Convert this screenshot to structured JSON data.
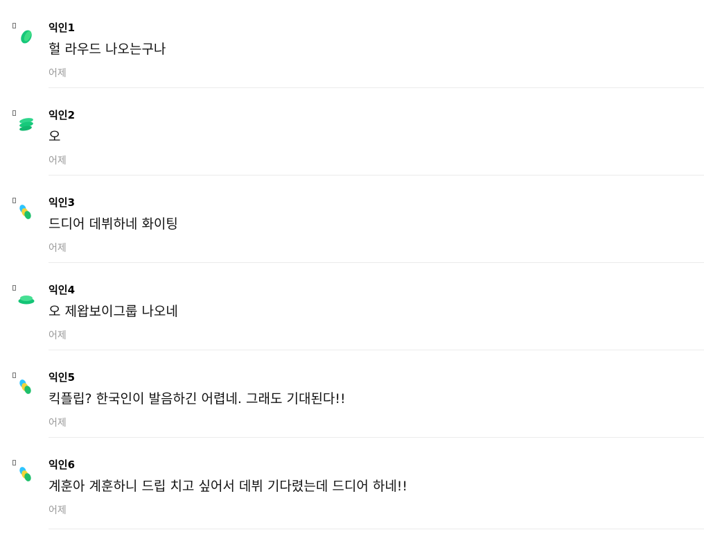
{
  "comments": [
    {
      "nickname": "익인1",
      "text": "헐 라우드 나오는구나",
      "time": "어제",
      "avatar_icon": "green-leaf-icon",
      "avatar_colors": [
        "#16c77a",
        "#3ddc84"
      ]
    },
    {
      "nickname": "익인2",
      "text": "오",
      "time": "어제",
      "avatar_icon": "green-stack-icon",
      "avatar_colors": [
        "#17c97b",
        "#2fd58c"
      ]
    },
    {
      "nickname": "익인3",
      "text": "드디어 데뷔하네 화이팅",
      "time": "어제",
      "avatar_icon": "colorful-bubbles-icon",
      "avatar_colors": [
        "#2ec4ff",
        "#f2d43a",
        "#1fbf6b"
      ]
    },
    {
      "nickname": "익인4",
      "text": "오 제왑보이그룹 나오네",
      "time": "어제",
      "avatar_icon": "green-cushion-icon",
      "avatar_colors": [
        "#14c476",
        "#46df93"
      ]
    },
    {
      "nickname": "익인5",
      "text": "킥플립? 한국인이 발음하긴 어렵네. 그래도 기대된다!!",
      "time": "어제",
      "avatar_icon": "colorful-bubbles-icon",
      "avatar_colors": [
        "#2ec4ff",
        "#f2d43a",
        "#1fbf6b"
      ]
    },
    {
      "nickname": "익인6",
      "text": "계훈아 계훈하니 드립 치고 싶어서 데뷔 기다렸는데 드디어 하네!!",
      "time": "어제",
      "avatar_icon": "colorful-bubbles-icon",
      "avatar_colors": [
        "#2ec4ff",
        "#f2d43a",
        "#1fbf6b"
      ]
    }
  ]
}
